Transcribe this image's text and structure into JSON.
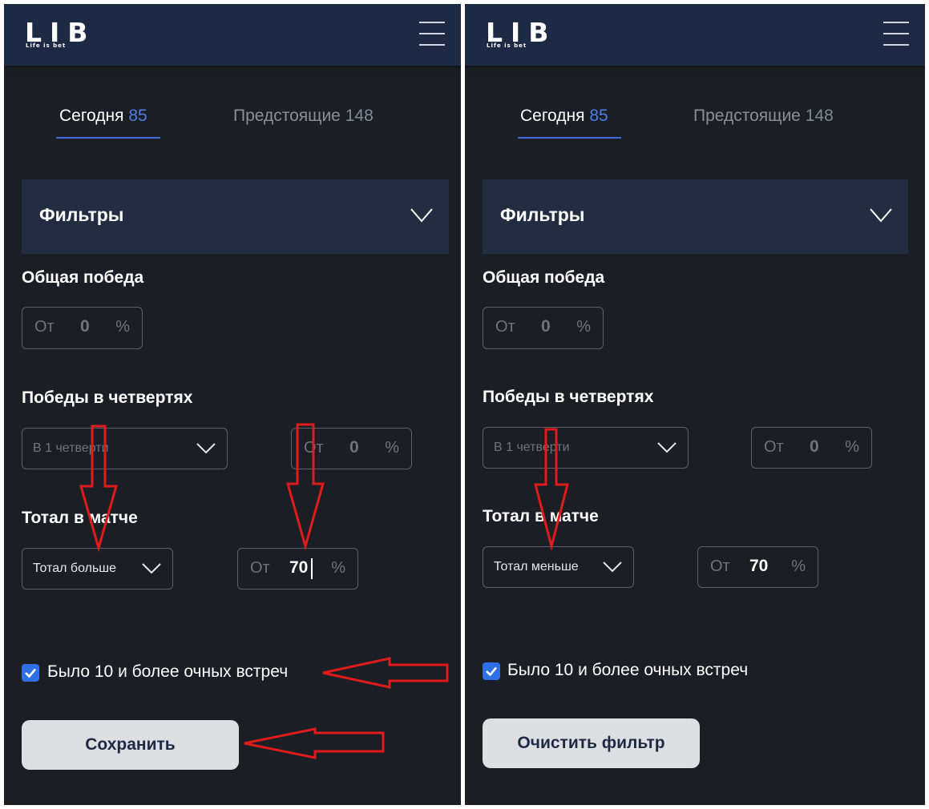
{
  "left_panel": {
    "logo_text": "LIB",
    "logo_sub": "Life is bet",
    "tabs": [
      {
        "label": "Сегодня",
        "count": "85"
      },
      {
        "label": "Предстоящие",
        "count": "148"
      }
    ],
    "filters_title": "Фильтры",
    "overall_win": {
      "label": "Общая победа",
      "from": "От",
      "value": "0",
      "unit": "%"
    },
    "quarter_wins": {
      "label": "Победы в четвертях",
      "select_value": "В 1 четверти",
      "from": "От",
      "value": "0",
      "unit": "%"
    },
    "match_total": {
      "label": "Тотал в матче",
      "select_value": "Тотал больше",
      "from": "От",
      "value": "70",
      "unit": "%"
    },
    "checkbox_label": "Было 10 и более очных встреч",
    "checkbox_checked": true,
    "action_button": "Сохранить"
  },
  "right_panel": {
    "logo_text": "LIB",
    "logo_sub": "Life is bet",
    "tabs": [
      {
        "label": "Сегодня",
        "count": "85"
      },
      {
        "label": "Предстоящие",
        "count": "148"
      }
    ],
    "filters_title": "Фильтры",
    "overall_win": {
      "label": "Общая победа",
      "from": "От",
      "value": "0",
      "unit": "%"
    },
    "quarter_wins": {
      "label": "Победы в четвертях",
      "select_value": "В 1 четверти",
      "from": "От",
      "value": "0",
      "unit": "%"
    },
    "match_total": {
      "label": "Тотал в матче",
      "select_value": "Тотал меньше",
      "from": "От",
      "value": "70",
      "unit": "%"
    },
    "checkbox_label": "Было 10 и более очных встреч",
    "checkbox_checked": true,
    "action_button": "Очистить фильтр"
  },
  "colors": {
    "background": "#1b1e24",
    "header": "#1e2a44",
    "filters_bar": "#232d42",
    "accent_blue": "#3f6ad8",
    "annotation_red": "#e01b1b",
    "button_bg": "#dedfe2"
  },
  "icons": [
    "menu-icon",
    "chevron-down-icon",
    "check-icon",
    "red-arrow-annotation"
  ]
}
